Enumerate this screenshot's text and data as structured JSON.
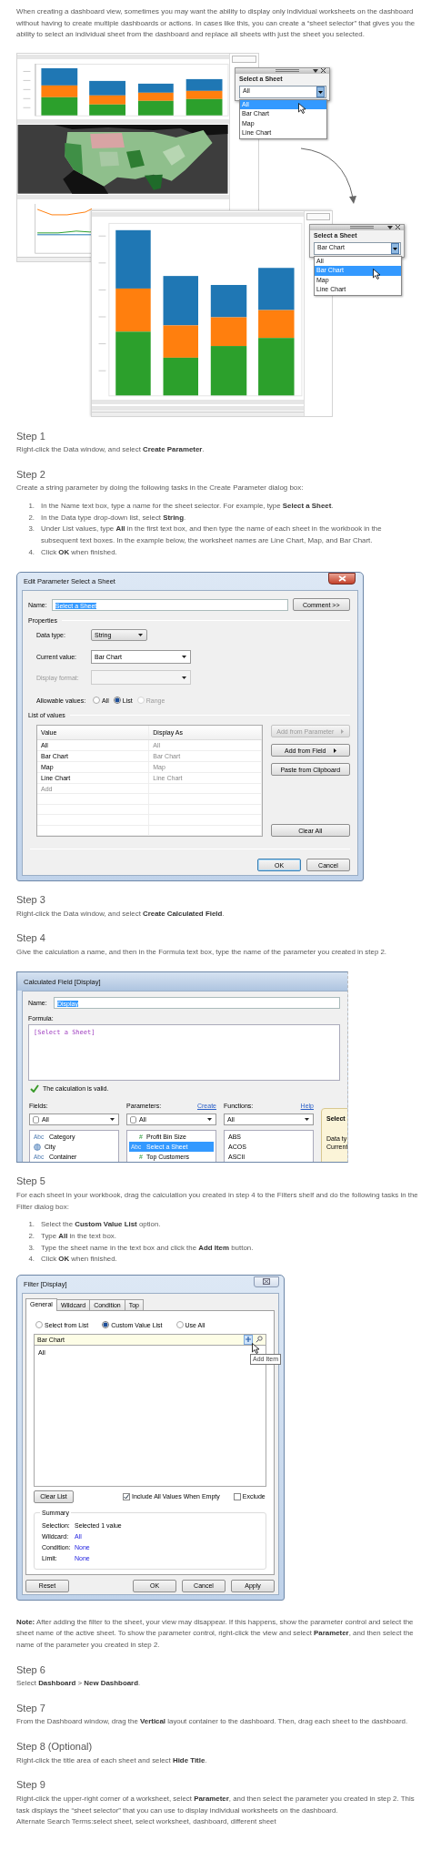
{
  "intro": "When creating a dashboard view, sometimes you may want the ability to display only individual worksheets on the dashboard without having to create multiple dashboards or actions. In cases like this, you can create a “sheet selector” that gives you the ability to select an individual sheet from the dashboard and replace all sheets with just the sheet you selected.",
  "figure": {
    "popups": [
      {
        "title": "Select a Sheet",
        "value": "All",
        "options": [
          {
            "label": "All",
            "selected": true
          },
          {
            "label": "Bar Chart",
            "selected": false
          },
          {
            "label": "Map",
            "selected": false
          },
          {
            "label": "Line Chart",
            "selected": false
          }
        ]
      },
      {
        "title": "Select a Sheet",
        "value": "Bar Chart",
        "options": [
          {
            "label": "All",
            "selected": false
          },
          {
            "label": "Bar Chart",
            "selected": true
          },
          {
            "label": "Map",
            "selected": false
          },
          {
            "label": "Line Chart",
            "selected": false
          }
        ]
      }
    ]
  },
  "blocks": [
    {
      "kind": "heading",
      "text": "Step 1"
    },
    {
      "kind": "paragraph",
      "text": "Right-click the Data window, and select **Create Parameter**."
    },
    {
      "kind": "heading",
      "text": "Step 2"
    },
    {
      "kind": "paragraph",
      "text": "Create a string parameter by doing the following tasks in the Create Parameter dialog box:"
    },
    {
      "kind": "list",
      "items": [
        {
          "number": "1.",
          "text": "In the Name text box, type a name for the sheet selector. For example, type **Select a Sheet**."
        },
        {
          "number": "2.",
          "text": "In the Data type drop-down list, select **String**."
        },
        {
          "number": "3.",
          "text": "Under List values, type **All** in the first text box, and then type the name of each sheet in the workbook in the subsequent text boxes. In the example below, the worksheet names are Line Chart, Map, and Bar Chart."
        },
        {
          "number": "4.",
          "text": "Click **OK** when finished."
        }
      ]
    },
    {
      "kind": "parameter_dialog",
      "title": "Edit Parameter Select a Sheet",
      "name_label": "Name:",
      "name_value": "Select a Sheet",
      "name_highlighted": true,
      "comment_button": "Comment >>",
      "properties_label": "Properties",
      "properties": [
        {
          "label": "Data type:",
          "value": "String",
          "disabled": false,
          "kind": "button"
        },
        {
          "label": "Current value:",
          "value": "Bar Chart",
          "disabled": false,
          "kind": "field"
        },
        {
          "label": "Display format:",
          "disabled": true,
          "kind": "field"
        }
      ],
      "allowable_label": "Allowable values:",
      "allowable": [
        {
          "label": "All",
          "selected": false,
          "disabled": false
        },
        {
          "label": "List",
          "selected": true,
          "disabled": false
        },
        {
          "label": "Range",
          "selected": false,
          "disabled": true
        }
      ],
      "list_label": "List of values",
      "columns": [
        "Value",
        "Display As"
      ],
      "rows": [
        {
          "value": "All",
          "display": "All"
        },
        {
          "value": "Bar Chart",
          "display": "Bar Chart"
        },
        {
          "value": "Map",
          "display": "Map"
        },
        {
          "value": "Line Chart",
          "display": "Line Chart"
        }
      ],
      "add_row": "Add",
      "side_buttons": [
        {
          "label": "Add from Parameter",
          "disabled": true,
          "submenu": true
        },
        {
          "label": "Add from Field",
          "disabled": false,
          "submenu": true
        },
        {
          "label": "Paste from Clipboard",
          "disabled": false,
          "submenu": false
        },
        {
          "label": "Clear All",
          "disabled": false,
          "submenu": false
        }
      ],
      "footer_buttons": [
        {
          "label": "OK",
          "default": true
        },
        {
          "label": "Cancel",
          "default": false
        }
      ]
    },
    {
      "kind": "heading",
      "text": "Step 3"
    },
    {
      "kind": "paragraph",
      "text": "Right-click the Data window, and select **Create Calculated Field**."
    },
    {
      "kind": "heading",
      "text": "Step 4"
    },
    {
      "kind": "paragraph",
      "text": "Give the calculation a name, and then in the Formula text box, type the name of the parameter you created in step 2."
    },
    {
      "kind": "calculation_dialog",
      "title": "Calculated Field [Display]",
      "name_label": "Name:",
      "name_value": "Display",
      "name_highlighted": true,
      "formula_label": "Formula:",
      "formula": "[Select a Sheet]",
      "status": "The calculation is valid.",
      "valid": true,
      "panes": [
        {
          "label": "Fields:",
          "filter": "All",
          "database": true,
          "items": [
            {
              "kind": "text",
              "badge": "Abc",
              "label": "Category",
              "selected": false
            },
            {
              "kind": "geo",
              "label": "City",
              "selected": false
            },
            {
              "kind": "text",
              "badge": "Abc",
              "label": "Container",
              "selected": false
            }
          ]
        },
        {
          "label": "Parameters:",
          "link": "Create",
          "filter": "All",
          "database": true,
          "items": [
            {
              "kind": "number",
              "badge": "#",
              "label": "Profit Bin Size",
              "selected": false
            },
            {
              "kind": "text",
              "badge": "Abc",
              "label": "Select a Sheet",
              "selected": true
            },
            {
              "kind": "number",
              "badge": "#",
              "label": "Top Customers",
              "selected": false
            }
          ]
        },
        {
          "label": "Functions:",
          "link": "Help",
          "filter": "All",
          "database": false,
          "items": [
            {
              "label": "ABS",
              "selected": false
            },
            {
              "label": "ACOS",
              "selected": false
            },
            {
              "label": "ASCII",
              "selected": false
            }
          ]
        }
      ],
      "help_card": {
        "title": "Select",
        "lines": [
          "Data ty",
          "Current"
        ]
      }
    },
    {
      "kind": "heading",
      "text": "Step 5"
    },
    {
      "kind": "paragraph",
      "text": "For each sheet in your workbook, drag the calculation you created in step 4 to the Filters shelf and do the following tasks in the Filter dialog box:"
    },
    {
      "kind": "list",
      "items": [
        {
          "number": "1.",
          "text": "Select the **Custom Value List** option."
        },
        {
          "number": "2.",
          "text": "Type **All** in the text box."
        },
        {
          "number": "3.",
          "text": "Type the sheet name in the text box and click the **Add Item** button."
        },
        {
          "number": "4.",
          "text": "Click **OK** when finished."
        }
      ]
    },
    {
      "kind": "filter_dialog",
      "title": "Filter [Display]",
      "tabs": [
        {
          "label": "General",
          "selected": true
        },
        {
          "label": "Wildcard",
          "selected": false
        },
        {
          "label": "Condition",
          "selected": false
        },
        {
          "label": "Top",
          "selected": false
        }
      ],
      "modes": [
        {
          "label": "Select from List",
          "selected": false
        },
        {
          "label": "Custom Value List",
          "selected": true
        },
        {
          "label": "Use All",
          "selected": false
        }
      ],
      "entry": "Bar Chart",
      "values": [
        "All"
      ],
      "tooltip": "Add Item",
      "clear_button": "Clear List",
      "options": [
        {
          "label": "Include All Values When Empty",
          "checked": true
        },
        {
          "label": "Exclude",
          "checked": false
        }
      ],
      "summary_label": "Summary",
      "summary": [
        {
          "label": "Selection:",
          "value": "Selected 1 value",
          "link": false
        },
        {
          "label": "Wildcard:",
          "value": "All",
          "link": true
        },
        {
          "label": "Condition:",
          "value": "None",
          "link": true
        },
        {
          "label": "Limit:",
          "value": "None",
          "link": true
        }
      ],
      "buttons": [
        {
          "label": "Reset"
        },
        {
          "label": "OK"
        },
        {
          "label": "Cancel"
        },
        {
          "label": "Apply"
        }
      ]
    },
    {
      "kind": "paragraph",
      "text": "**Note:** After adding the filter to the sheet, your view may disappear. If this happens, show the parameter control and select the sheet name of the active sheet. To show the parameter control, right-click the view and select **Parameter**, and then select the name of the parameter you created in step 2."
    },
    {
      "kind": "heading",
      "text": "Step 6"
    },
    {
      "kind": "paragraph",
      "text": "Select **Dashboard** > **New Dashboard**."
    },
    {
      "kind": "heading",
      "text": "Step 7"
    },
    {
      "kind": "paragraph",
      "text": "From the Dashboard window, drag the **Vertical** layout container to the dashboard. Then, drag each sheet to the dashboard."
    },
    {
      "kind": "heading",
      "text": "Step 8 (Optional)"
    },
    {
      "kind": "paragraph",
      "text": "Right-click the title area of each sheet and select **Hide Title**."
    },
    {
      "kind": "heading",
      "text": "Step 9"
    },
    {
      "kind": "paragraph",
      "text": "Right-click the upper-right corner of a worksheet, select **Parameter**, and then select the parameter you created in step 2. This task displays the “sheet selector” that you can use to display individual worksheets on the dashboard."
    },
    {
      "kind": "paragraph",
      "text": "Alternate Search Terms:select sheet, select worksheet, dashboard, different sheet"
    }
  ]
}
